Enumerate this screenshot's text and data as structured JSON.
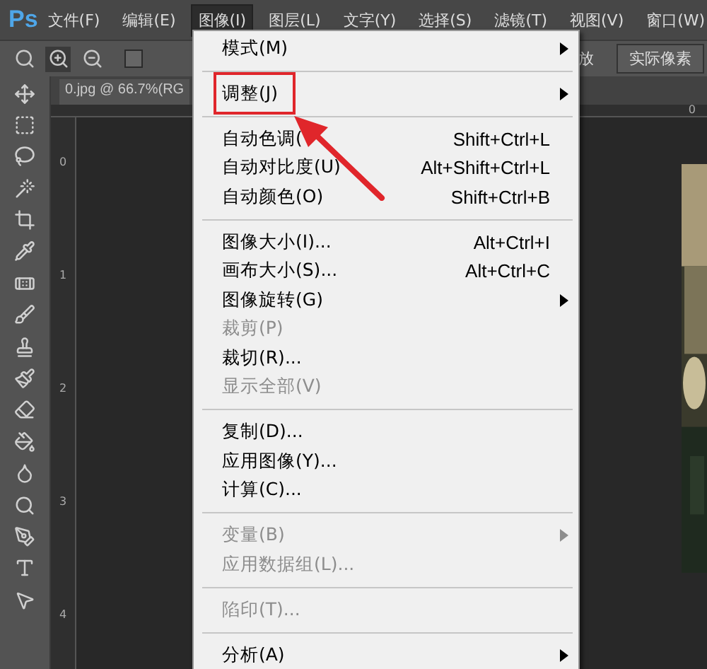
{
  "menubar": {
    "logo": "Ps",
    "items": [
      {
        "label": "文件(F)",
        "selected": false
      },
      {
        "label": "编辑(E)",
        "selected": false
      },
      {
        "label": "图像(I)",
        "selected": true
      },
      {
        "label": "图层(L)",
        "selected": false
      },
      {
        "label": "文字(Y)",
        "selected": false
      },
      {
        "label": "选择(S)",
        "selected": false
      },
      {
        "label": "滤镜(T)",
        "selected": false
      },
      {
        "label": "视图(V)",
        "selected": false
      },
      {
        "label": "窗口(W)",
        "selected": false
      }
    ]
  },
  "options_bar": {
    "zoom_in_active": true,
    "checkbox_checked": false,
    "partial_label": "放",
    "button": "实际像素"
  },
  "document_tab": {
    "title": "0.jpg @ 66.7%(RG"
  },
  "rulers": {
    "horizontal": [
      "0"
    ],
    "vertical": [
      "0",
      "1",
      "2",
      "3",
      "4"
    ]
  },
  "image_menu": {
    "items": [
      {
        "kind": "item",
        "label": "模式(M)",
        "submenu": true,
        "disabled": false,
        "annotated": false
      },
      {
        "kind": "separator"
      },
      {
        "kind": "item",
        "label": "调整(J)",
        "submenu": true,
        "disabled": false,
        "annotated": true
      },
      {
        "kind": "separator"
      },
      {
        "kind": "item",
        "label": "自动色调(",
        "shortcut": "Shift+Ctrl+L",
        "submenu": false,
        "disabled": false,
        "annotated": false
      },
      {
        "kind": "item",
        "label": "自动对比度(U)",
        "shortcut": "Alt+Shift+Ctrl+L",
        "submenu": false,
        "disabled": false,
        "annotated": false
      },
      {
        "kind": "item",
        "label": "自动颜色(O)",
        "shortcut": "Shift+Ctrl+B",
        "submenu": false,
        "disabled": false,
        "annotated": false
      },
      {
        "kind": "separator"
      },
      {
        "kind": "item",
        "label": "图像大小(I)...",
        "shortcut": "Alt+Ctrl+I",
        "submenu": false,
        "disabled": false,
        "annotated": false
      },
      {
        "kind": "item",
        "label": "画布大小(S)...",
        "shortcut": "Alt+Ctrl+C",
        "submenu": false,
        "disabled": false,
        "annotated": false
      },
      {
        "kind": "item",
        "label": "图像旋转(G)",
        "submenu": true,
        "disabled": false,
        "annotated": false
      },
      {
        "kind": "item",
        "label": "裁剪(P)",
        "submenu": false,
        "disabled": true,
        "annotated": false
      },
      {
        "kind": "item",
        "label": "裁切(R)...",
        "submenu": false,
        "disabled": false,
        "annotated": false
      },
      {
        "kind": "item",
        "label": "显示全部(V)",
        "submenu": false,
        "disabled": true,
        "annotated": false
      },
      {
        "kind": "separator"
      },
      {
        "kind": "item",
        "label": "复制(D)...",
        "submenu": false,
        "disabled": false,
        "annotated": false
      },
      {
        "kind": "item",
        "label": "应用图像(Y)...",
        "submenu": false,
        "disabled": false,
        "annotated": false
      },
      {
        "kind": "item",
        "label": "计算(C)...",
        "submenu": false,
        "disabled": false,
        "annotated": false
      },
      {
        "kind": "separator"
      },
      {
        "kind": "item",
        "label": "变量(B)",
        "submenu": true,
        "disabled": true,
        "annotated": false
      },
      {
        "kind": "item",
        "label": "应用数据组(L)...",
        "submenu": false,
        "disabled": true,
        "annotated": false
      },
      {
        "kind": "separator"
      },
      {
        "kind": "item",
        "label": "陷印(T)...",
        "submenu": false,
        "disabled": true,
        "annotated": false
      },
      {
        "kind": "separator"
      },
      {
        "kind": "item",
        "label": "分析(A)",
        "submenu": true,
        "disabled": false,
        "annotated": false
      }
    ]
  }
}
